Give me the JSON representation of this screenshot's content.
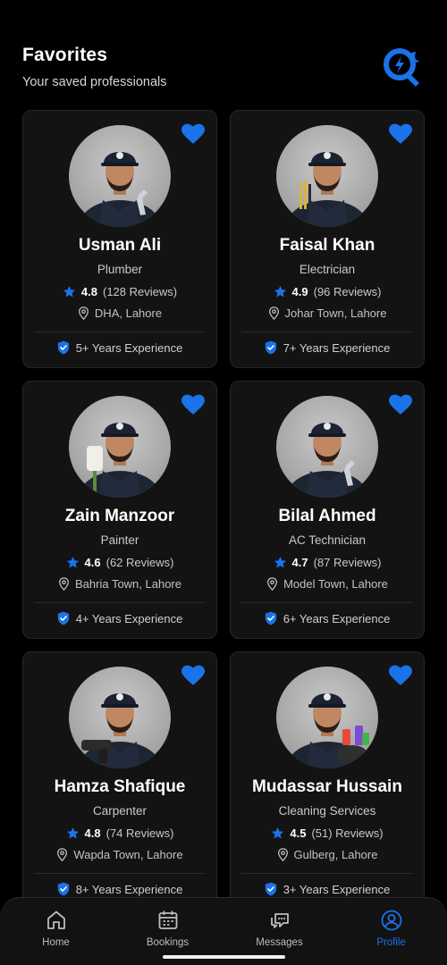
{
  "header": {
    "title": "Favorites",
    "subtitle": "Your saved professionals"
  },
  "colors": {
    "accent": "#1a73e8",
    "card": "#131313",
    "background": "#000000"
  },
  "cards": [
    {
      "name": "Usman Ali",
      "role": "Plumber",
      "rating": "4.8",
      "reviews": "(128 Reviews)",
      "location": "DHA, Lahore",
      "experience": "5+ Years Experience",
      "tool": "wrench"
    },
    {
      "name": "Faisal Khan",
      "role": "Electrician",
      "rating": "4.9",
      "reviews": "(96 Reviews)",
      "location": "Johar Town, Lahore",
      "experience": "7+ Years Experience",
      "tool": "screwdrivers"
    },
    {
      "name": "Zain Manzoor",
      "role": "Painter",
      "rating": "4.6",
      "reviews": "(62 Reviews)",
      "location": "Bahria Town, Lahore",
      "experience": "4+ Years Experience",
      "tool": "paint-roller"
    },
    {
      "name": "Bilal Ahmed",
      "role": "AC Technician",
      "rating": "4.7",
      "reviews": "(87 Reviews)",
      "location": "Model Town, Lahore",
      "experience": "6+ Years Experience",
      "tool": "wrench"
    },
    {
      "name": "Hamza Shafique",
      "role": "Carpenter",
      "rating": "4.8",
      "reviews": "(74 Reviews)",
      "location": "Wapda Town, Lahore",
      "experience": "8+ Years Experience",
      "tool": "drill"
    },
    {
      "name": "Mudassar Hussain",
      "role": "Cleaning Services",
      "rating": "4.5",
      "reviews": "(51) Reviews)",
      "location": "Gulberg, Lahore",
      "experience": "3+ Years Experience",
      "tool": "cleaning-supplies"
    }
  ],
  "nav": {
    "items": [
      {
        "label": "Home",
        "icon": "home-icon"
      },
      {
        "label": "Bookings",
        "icon": "calendar-icon"
      },
      {
        "label": "Messages",
        "icon": "chat-icon"
      },
      {
        "label": "Profile",
        "icon": "profile-icon"
      }
    ],
    "active": "Profile"
  }
}
